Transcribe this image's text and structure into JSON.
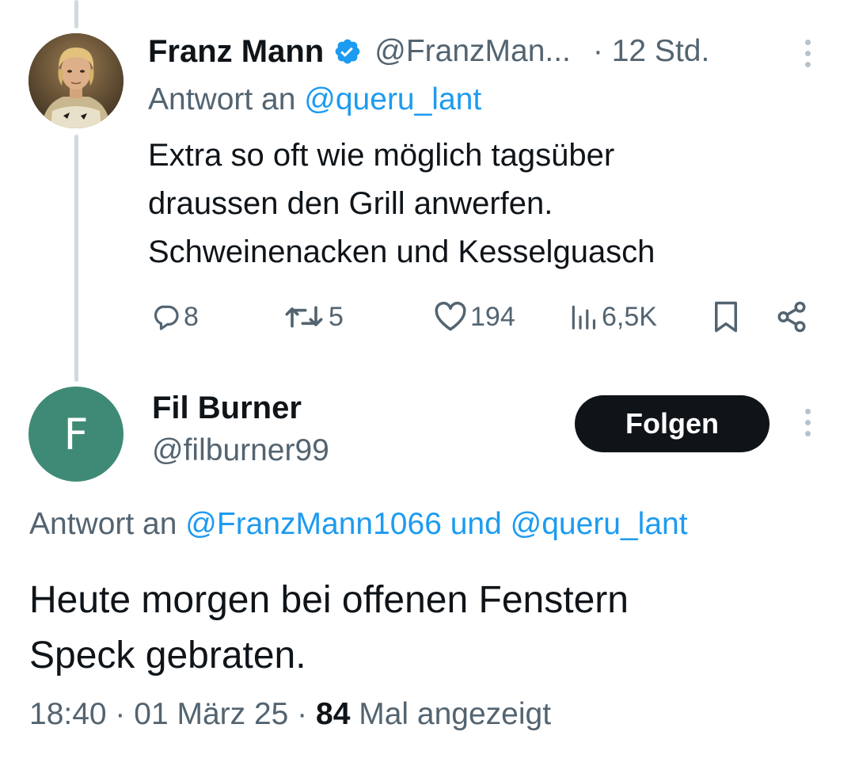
{
  "parent_tweet": {
    "author_name": "Franz Mann",
    "author_handle": "@FranzMan...",
    "time": "· 12 Std.",
    "reply_prefix": "Antwort an",
    "reply_handle": "@queru_lant",
    "text_lines": [
      "Extra so oft wie möglich tagsüber",
      "draussen den Grill anwerfen.",
      "Schweinenacken und Kesselguasch"
    ],
    "stats": {
      "replies": "8",
      "retweets": "5",
      "likes": "194",
      "views": "6,5K"
    }
  },
  "main_tweet": {
    "author_name": "Fil Burner",
    "author_handle": "@filburner99",
    "avatar_letter": "F",
    "follow_label": "Folgen",
    "reply_prefix": "Antwort an",
    "reply_handle_1": "@FranzMann1066",
    "reply_and": "und",
    "reply_handle_2": "@queru_lant",
    "text_lines": [
      "Heute morgen bei offenen Fenstern",
      "Speck gebraten."
    ],
    "timestamp": "18:40 · 01 März 25 ·",
    "views_count": "84",
    "views_label": "Mal angezeigt"
  },
  "colors": {
    "accent_link": "#1d9bf0",
    "muted_text": "#536471",
    "primary_text": "#0f1419",
    "avatar_fil_bg": "#3f8a76",
    "verified_badge": "#1d9bf0"
  }
}
